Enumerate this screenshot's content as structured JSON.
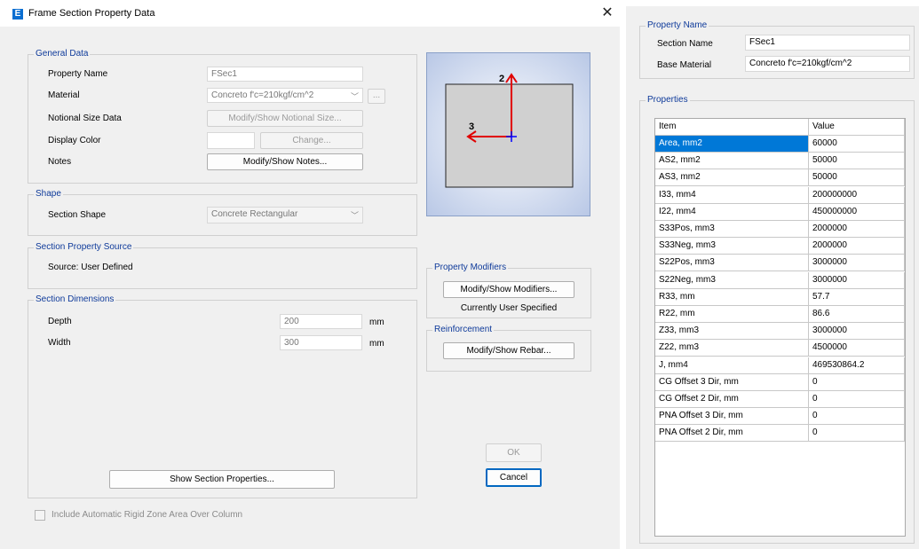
{
  "dialog": {
    "title": "Frame Section Property Data",
    "app_icon": "E",
    "close_glyph": "✕"
  },
  "general_data": {
    "legend": "General Data",
    "property_name_label": "Property Name",
    "property_name_value": "FSec1",
    "material_label": "Material",
    "material_value": "Concreto f'c=210kgf/cm^2",
    "material_more": "...",
    "notional_label": "Notional Size Data",
    "notional_button": "Modify/Show Notional Size...",
    "display_color_label": "Display Color",
    "change_button": "Change...",
    "notes_label": "Notes",
    "notes_button": "Modify/Show Notes..."
  },
  "shape": {
    "legend": "Shape",
    "section_shape_label": "Section Shape",
    "section_shape_value": "Concrete Rectangular"
  },
  "source": {
    "legend": "Section Property Source",
    "text": "Source:  User Defined"
  },
  "dimensions": {
    "legend": "Section Dimensions",
    "depth_label": "Depth",
    "depth_value": "200",
    "depth_unit": "mm",
    "width_label": "Width",
    "width_value": "300",
    "width_unit": "mm",
    "show_props_button": "Show Section Properties..."
  },
  "preview": {
    "axis2": "2",
    "axis3": "3",
    "colors": {
      "background": "#c8d4ec",
      "section": "#d0d0d0",
      "axis": "#e00000",
      "origin": "#0000ff"
    }
  },
  "modifiers": {
    "legend": "Property Modifiers",
    "button": "Modify/Show Modifiers...",
    "status": "Currently User Specified"
  },
  "reinforcement": {
    "legend": "Reinforcement",
    "button": "Modify/Show Rebar..."
  },
  "actions": {
    "ok": "OK",
    "cancel": "Cancel"
  },
  "rigid_zone": {
    "label": "Include Automatic Rigid Zone Area Over Column",
    "checked": false
  },
  "right_panel": {
    "property_name_legend": "Property Name",
    "section_name_label": "Section Name",
    "section_name_value": "FSec1",
    "base_material_label": "Base Material",
    "base_material_value": "Concreto f'c=210kgf/cm^2",
    "properties_legend": "Properties",
    "columns": [
      "Item",
      "Value"
    ],
    "rows": [
      [
        "Area, mm2",
        "60000"
      ],
      [
        "AS2, mm2",
        "50000"
      ],
      [
        "AS3, mm2",
        "50000"
      ],
      [
        "I33, mm4",
        "200000000"
      ],
      [
        "I22, mm4",
        "450000000"
      ],
      [
        "S33Pos, mm3",
        "2000000"
      ],
      [
        "S33Neg, mm3",
        "2000000"
      ],
      [
        "S22Pos, mm3",
        "3000000"
      ],
      [
        "S22Neg, mm3",
        "3000000"
      ],
      [
        "R33, mm",
        "57.7"
      ],
      [
        "R22, mm",
        "86.6"
      ],
      [
        "Z33, mm3",
        "3000000"
      ],
      [
        "Z22, mm3",
        "4500000"
      ],
      [
        "J, mm4",
        "469530864.2"
      ],
      [
        "CG Offset 3 Dir, mm",
        "0"
      ],
      [
        "CG Offset 2 Dir, mm",
        "0"
      ],
      [
        "PNA Offset 3 Dir, mm",
        "0"
      ],
      [
        "PNA Offset 2 Dir, mm",
        "0"
      ]
    ]
  }
}
